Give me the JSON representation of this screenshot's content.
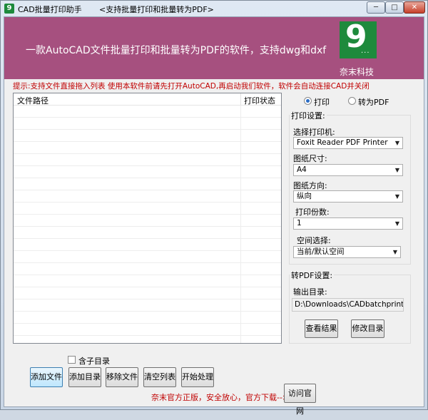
{
  "window": {
    "app_icon": "9",
    "title": "CAD批量打印助手",
    "subtitle": "<支持批量打印和批量转为PDF>",
    "min_glyph": "─",
    "max_glyph": "□",
    "close_glyph": "✕"
  },
  "banner": {
    "text": "一款AutoCAD文件批量打印和批量转为PDF的软件，支持dwg和dxf",
    "logo_digit": "9",
    "logo_dots": "...",
    "brand": "奈末科技",
    "color": "#a6507f"
  },
  "hint": "提示:支持文件直接拖入列表 使用本软件前请先打开AutoCAD,再启动我们软件，软件会自动连接CAD并关闭",
  "file_list": {
    "columns": [
      "文件路径",
      "打印状态"
    ],
    "rows": []
  },
  "mode": {
    "print_label": "打印",
    "pdf_label": "转为PDF",
    "selected": "print"
  },
  "print_settings": {
    "title": "打印设置:",
    "printer_label": "选择打印机:",
    "printer_value": "Foxit Reader PDF Printer",
    "size_label": "图纸尺寸:",
    "size_value": "A4",
    "orientation_label": "图纸方向:",
    "orientation_value": "纵向",
    "copies_label": "打印份数:",
    "copies_value": "1",
    "space_label": "空间选择:",
    "space_value": "当前/默认空间"
  },
  "pdf_settings": {
    "title": "转PDF设置:",
    "output_label": "输出目录:",
    "output_value": "D:\\Downloads\\CADbatchprint\\CADI",
    "view_button": "查看结果",
    "modify_button": "修改目录"
  },
  "bottom": {
    "subdir_label": "含子目录",
    "add_file": "添加文件",
    "add_dir": "添加目录",
    "remove_file": "移除文件",
    "clear_list": "清空列表",
    "start": "开始处理",
    "note": "奈末官方正版，安全放心，官方下载-->",
    "visit_site": "访问官网"
  },
  "colors": {
    "accent_red": "#c00000",
    "logo_green": "#1e8a3c"
  }
}
